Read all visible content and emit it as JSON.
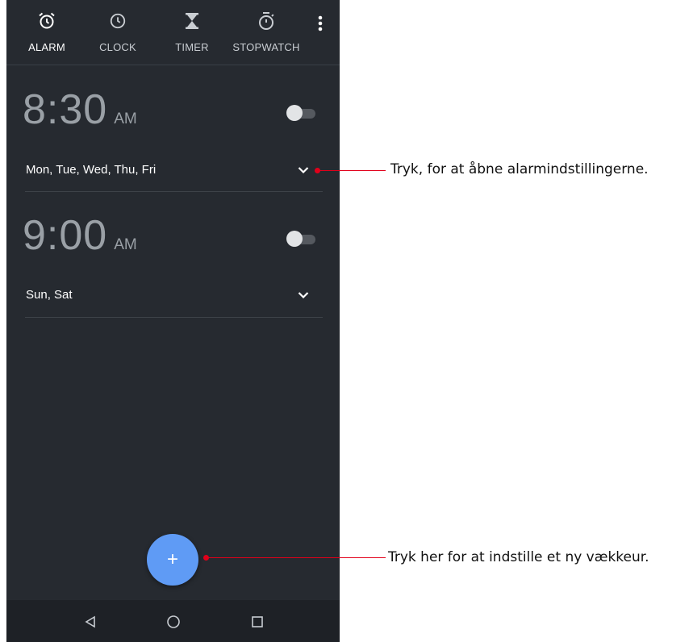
{
  "tabs": [
    {
      "label": "ALARM",
      "icon": "alarm-clock-icon",
      "active": true
    },
    {
      "label": "CLOCK",
      "icon": "clock-icon",
      "active": false
    },
    {
      "label": "TIMER",
      "icon": "hourglass-icon",
      "active": false
    },
    {
      "label": "STOPWATCH",
      "icon": "stopwatch-icon",
      "active": false
    }
  ],
  "alarms": [
    {
      "time": "8:30",
      "ampm": "AM",
      "days": "Mon, Tue, Wed, Thu, Fri",
      "enabled": false
    },
    {
      "time": "9:00",
      "ampm": "AM",
      "days": "Sun, Sat",
      "enabled": false
    }
  ],
  "fab": {
    "label": "+"
  },
  "callouts": {
    "expand": "Tryk, for at åbne alarmindstillingerne.",
    "add": "Tryk her for at indstille et ny vækkeur."
  },
  "colors": {
    "background": "#262a30",
    "fab": "#5f9bf5",
    "callout_line": "#e1001a"
  }
}
